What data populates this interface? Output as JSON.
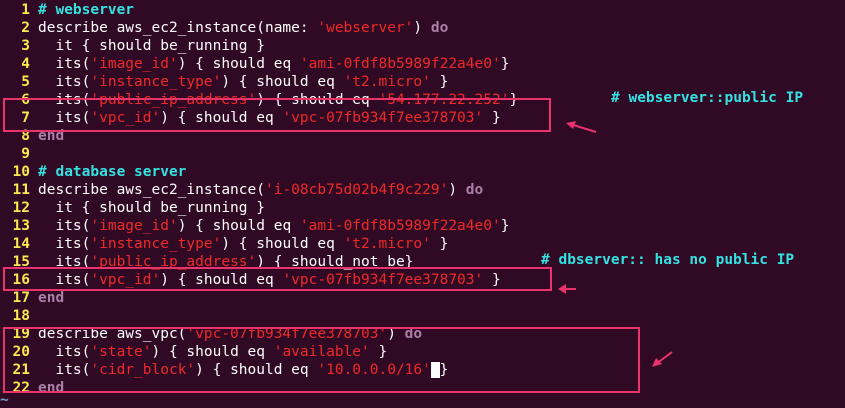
{
  "editor": {
    "lines": [
      {
        "n": "1",
        "parts": [
          [
            "cm",
            "# webserver"
          ]
        ]
      },
      {
        "n": "2",
        "parts": [
          [
            "sym",
            "describe aws_ec2_instance(name: "
          ],
          [
            "st",
            "'webserver'"
          ],
          [
            "sym",
            ") "
          ],
          [
            "kw",
            "do"
          ]
        ]
      },
      {
        "n": "3",
        "parts": [
          [
            "sym",
            "  it { should be_running }"
          ]
        ]
      },
      {
        "n": "4",
        "parts": [
          [
            "sym",
            "  its("
          ],
          [
            "st",
            "'image_id'"
          ],
          [
            "sym",
            ") { should eq "
          ],
          [
            "st",
            "'ami-0fdf8b5989f22a4e0'"
          ],
          [
            "sym",
            "}"
          ]
        ]
      },
      {
        "n": "5",
        "parts": [
          [
            "sym",
            "  its("
          ],
          [
            "st",
            "'instance_type'"
          ],
          [
            "sym",
            ") { should eq "
          ],
          [
            "st",
            "'t2.micro'"
          ],
          [
            "sym",
            " }"
          ]
        ]
      },
      {
        "n": "6",
        "parts": [
          [
            "sym",
            "  its("
          ],
          [
            "st",
            "'public_ip_address'"
          ],
          [
            "sym",
            ") { should eq "
          ],
          [
            "st",
            "'54.177.22.252'"
          ],
          [
            "sym",
            "}"
          ]
        ]
      },
      {
        "n": "7",
        "parts": [
          [
            "sym",
            "  its("
          ],
          [
            "st",
            "'vpc_id'"
          ],
          [
            "sym",
            ") { should eq "
          ],
          [
            "st",
            "'vpc-07fb934f7ee378703'"
          ],
          [
            "sym",
            " }"
          ]
        ]
      },
      {
        "n": "8",
        "parts": [
          [
            "kw",
            "end"
          ]
        ]
      },
      {
        "n": "9",
        "parts": []
      },
      {
        "n": "10",
        "parts": [
          [
            "cm",
            "# database server"
          ]
        ]
      },
      {
        "n": "11",
        "parts": [
          [
            "sym",
            "describe aws_ec2_instance("
          ],
          [
            "st",
            "'i-08cb75d02b4f9c229'"
          ],
          [
            "sym",
            ") "
          ],
          [
            "kw",
            "do"
          ]
        ]
      },
      {
        "n": "12",
        "parts": [
          [
            "sym",
            "  it { should be_running }"
          ]
        ]
      },
      {
        "n": "13",
        "parts": [
          [
            "sym",
            "  its("
          ],
          [
            "st",
            "'image_id'"
          ],
          [
            "sym",
            ") { should eq "
          ],
          [
            "st",
            "'ami-0fdf8b5989f22a4e0'"
          ],
          [
            "sym",
            "}"
          ]
        ]
      },
      {
        "n": "14",
        "parts": [
          [
            "sym",
            "  its("
          ],
          [
            "st",
            "'instance_type'"
          ],
          [
            "sym",
            ") { should eq "
          ],
          [
            "st",
            "'t2.micro'"
          ],
          [
            "sym",
            " }"
          ]
        ]
      },
      {
        "n": "15",
        "parts": [
          [
            "sym",
            "  its("
          ],
          [
            "st",
            "'public_ip_address'"
          ],
          [
            "sym",
            ") { should_not be}"
          ]
        ]
      },
      {
        "n": "16",
        "parts": [
          [
            "sym",
            "  its("
          ],
          [
            "st",
            "'vpc_id'"
          ],
          [
            "sym",
            ") { should eq "
          ],
          [
            "st",
            "'vpc-07fb934f7ee378703'"
          ],
          [
            "sym",
            " }"
          ]
        ]
      },
      {
        "n": "17",
        "parts": [
          [
            "kw",
            "end"
          ]
        ]
      },
      {
        "n": "18",
        "parts": []
      },
      {
        "n": "19",
        "parts": [
          [
            "sym",
            "describe aws_vpc("
          ],
          [
            "st",
            "'vpc-07fb934f7ee378703'"
          ],
          [
            "sym",
            ") "
          ],
          [
            "kw",
            "do"
          ]
        ]
      },
      {
        "n": "20",
        "parts": [
          [
            "sym",
            "  its("
          ],
          [
            "st",
            "'state'"
          ],
          [
            "sym",
            ") { should eq "
          ],
          [
            "st",
            "'available'"
          ],
          [
            "sym",
            " }"
          ]
        ]
      },
      {
        "n": "21",
        "parts": [
          [
            "sym",
            "  its("
          ],
          [
            "st",
            "'cidr_block'"
          ],
          [
            "sym",
            ") { should eq "
          ],
          [
            "st",
            "'10.0.0.0/16'"
          ],
          [
            "cursor",
            " "
          ],
          [
            "sym",
            "}"
          ]
        ]
      },
      {
        "n": "22",
        "parts": [
          [
            "kw",
            "end"
          ]
        ]
      }
    ],
    "tilde": "~"
  },
  "annotations": {
    "webserver_comment": "# webserver::public IP",
    "dbserver_comment": "# dbserver:: has no public IP"
  },
  "colors": {
    "background": "#300a24",
    "line_number": "#fce94f",
    "keyword": "#ad7fa8",
    "comment": "#34e2e2",
    "string": "#ef2929",
    "highlight": "#e8336b"
  }
}
